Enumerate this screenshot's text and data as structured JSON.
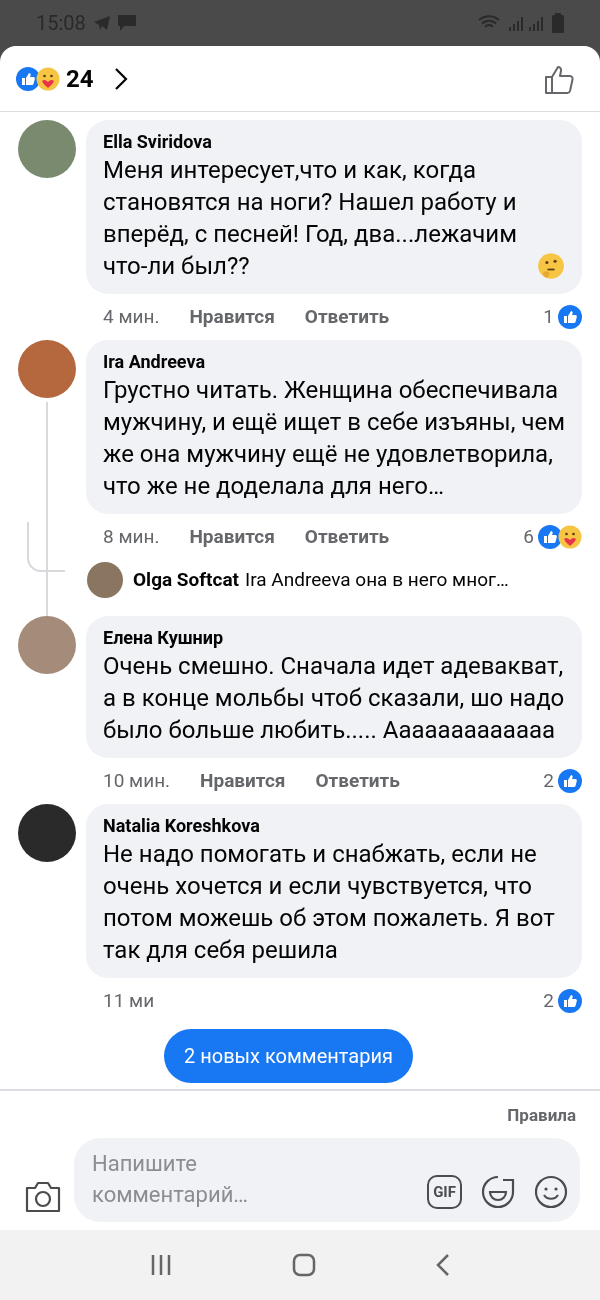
{
  "status_bar": {
    "time": "15:08"
  },
  "header": {
    "reaction_count": "24",
    "reactions": [
      {
        "kind": "like"
      },
      {
        "kind": "care"
      }
    ]
  },
  "comments": [
    {
      "author": "Ella Sviridova",
      "text": "Меня интересует,что и как, когда становятся на ноги? Нашел работу и вперёд, с песней! Год, два...лежачим что-ли был??",
      "time": "4 мин.",
      "like_label": "Нравится",
      "reply_label": "Ответить",
      "reaction_count": "1",
      "reactions": [
        {
          "kind": "like"
        }
      ],
      "thinking_emoji": true
    },
    {
      "author": "Ira Andreeva",
      "text": "Грустно читать. Женщина обеспечивала мужчину, и ещё ищет  в себе изъяны, чем же она мужчину ещё не удовлетворила, что же не доделала для него…",
      "time": "8 мин.",
      "like_label": "Нравится",
      "reply_label": "Ответить",
      "reaction_count": "6",
      "reactions": [
        {
          "kind": "like"
        },
        {
          "kind": "care"
        }
      ],
      "replies": [
        {
          "author": "Olga Softcat",
          "text": "Ira Andreeva она в него мног…"
        }
      ]
    },
    {
      "author": "Елена Кушнир",
      "text": "Очень смешно. Сначала идет адевакват, а в конце мольбы чтоб сказали, шо надо было больше любить..... Ааааааааааааа",
      "time": "10 мин.",
      "like_label": "Нравится",
      "reply_label": "Ответить",
      "reaction_count": "2",
      "reactions": [
        {
          "kind": "like"
        }
      ]
    },
    {
      "author": "Natalia Koreshkova",
      "text": "Не надо помогать и снабжать, если не очень хочется и если чувствуется, что потом можешь об этом пожалеть. Я вот так для себя решила",
      "time": "11 ми",
      "reaction_count": "2",
      "reactions": [
        {
          "kind": "like"
        }
      ]
    }
  ],
  "new_comments_button": "2 новых комментария",
  "rules_link": "Правила",
  "composer": {
    "placeholder": "Напишите комментарий…",
    "gif_label": "GIF"
  }
}
